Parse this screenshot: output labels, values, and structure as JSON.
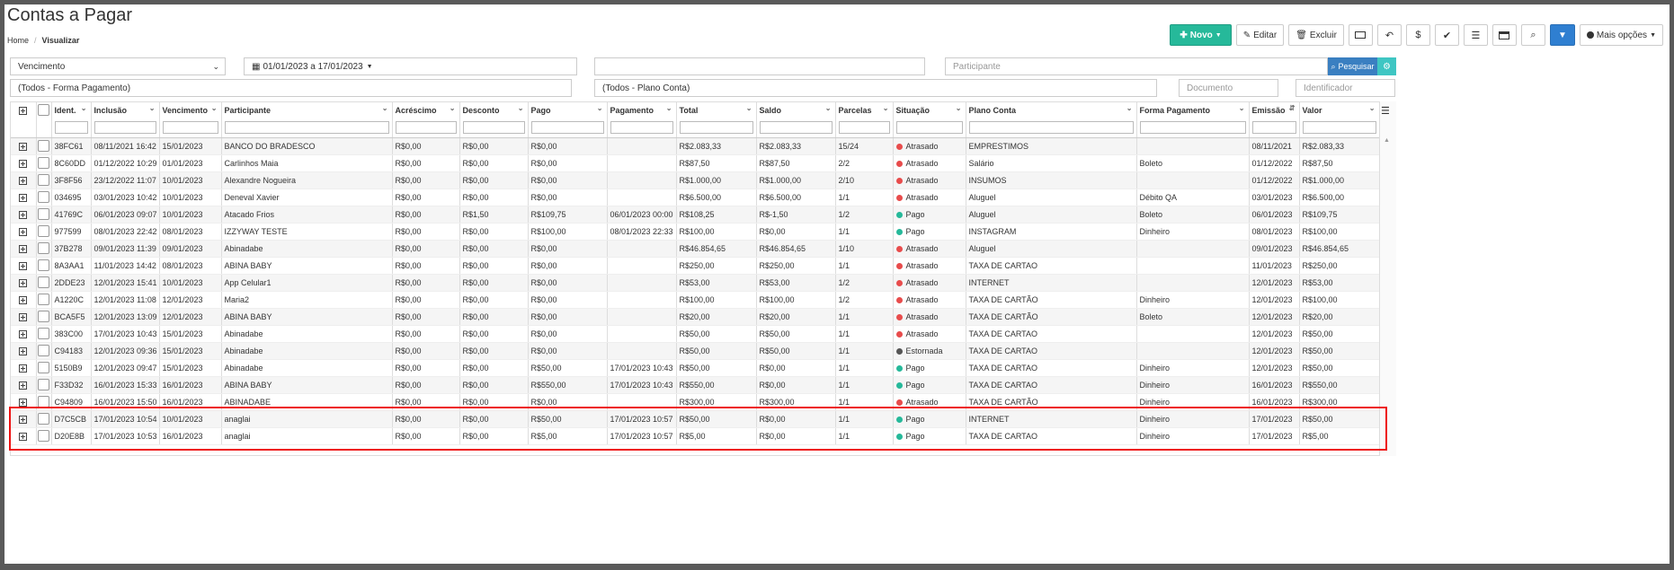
{
  "page": {
    "title": "Contas a Pagar"
  },
  "breadcrumb": {
    "home": "Home",
    "current": "Visualizar"
  },
  "toolbar": {
    "novo": "Novo",
    "editar": "Editar",
    "excluir": "Excluir",
    "mais_opcoes": "Mais opções",
    "dollar_glyph": "$"
  },
  "filters": {
    "date_field": "Vencimento",
    "date_range": "01/01/2023 a 17/01/2023",
    "text_search": "",
    "participante_placeholder": "Participante",
    "pesquisar": "Pesquisar",
    "forma_pagamento": "(Todos - Forma Pagamento)",
    "plano_conta": "(Todos - Plano Conta)",
    "documento_placeholder": "Documento",
    "identificador_placeholder": "Identificador"
  },
  "table": {
    "columns": [
      "Ident.",
      "Inclusão",
      "Vencimento",
      "Participante",
      "Acréscimo",
      "Desconto",
      "Pago",
      "Pagamento",
      "Total",
      "Saldo",
      "Parcelas",
      "Situação",
      "Plano Conta",
      "Forma Pagamento",
      "Emissão",
      "Valor"
    ],
    "status_colors": {
      "Atrasado": "#e84c4c",
      "Pago": "#26b99a",
      "Estornada": "#555555"
    },
    "rows": [
      [
        "38FC61",
        "08/11/2021 16:42",
        "15/01/2023",
        "BANCO DO BRADESCO",
        "R$0,00",
        "R$0,00",
        "R$0,00",
        "",
        "R$2.083,33",
        "R$2.083,33",
        "15/24",
        "Atrasado",
        "EMPRESTIMOS",
        "",
        "08/11/2021",
        "R$2.083,33"
      ],
      [
        "8C60DD",
        "01/12/2022 10:29",
        "01/01/2023",
        "Carlinhos Maia",
        "R$0,00",
        "R$0,00",
        "R$0,00",
        "",
        "R$87,50",
        "R$87,50",
        "2/2",
        "Atrasado",
        "Salário",
        "Boleto",
        "01/12/2022",
        "R$87,50"
      ],
      [
        "3F8F56",
        "23/12/2022 11:07",
        "10/01/2023",
        "Alexandre Nogueira",
        "R$0,00",
        "R$0,00",
        "R$0,00",
        "",
        "R$1.000,00",
        "R$1.000,00",
        "2/10",
        "Atrasado",
        "INSUMOS",
        "",
        "01/12/2022",
        "R$1.000,00"
      ],
      [
        "034695",
        "03/01/2023 10:42",
        "10/01/2023",
        "Deneval Xavier",
        "R$0,00",
        "R$0,00",
        "R$0,00",
        "",
        "R$6.500,00",
        "R$6.500,00",
        "1/1",
        "Atrasado",
        "Aluguel",
        "Débito QA",
        "03/01/2023",
        "R$6.500,00"
      ],
      [
        "41769C",
        "06/01/2023 09:07",
        "10/01/2023",
        "Atacado Frios",
        "R$0,00",
        "R$1,50",
        "R$109,75",
        "06/01/2023 00:00",
        "R$108,25",
        "R$-1,50",
        "1/2",
        "Pago",
        "Aluguel",
        "Boleto",
        "06/01/2023",
        "R$109,75"
      ],
      [
        "977599",
        "08/01/2023 22:42",
        "08/01/2023",
        "IZZYWAY TESTE",
        "R$0,00",
        "R$0,00",
        "R$100,00",
        "08/01/2023 22:33",
        "R$100,00",
        "R$0,00",
        "1/1",
        "Pago",
        "INSTAGRAM",
        "Dinheiro",
        "08/01/2023",
        "R$100,00"
      ],
      [
        "37B278",
        "09/01/2023 11:39",
        "09/01/2023",
        "Abinadabe",
        "R$0,00",
        "R$0,00",
        "R$0,00",
        "",
        "R$46.854,65",
        "R$46.854,65",
        "1/10",
        "Atrasado",
        "Aluguel",
        "",
        "09/01/2023",
        "R$46.854,65"
      ],
      [
        "8A3AA1",
        "11/01/2023 14:42",
        "08/01/2023",
        "ABINA BABY",
        "R$0,00",
        "R$0,00",
        "R$0,00",
        "",
        "R$250,00",
        "R$250,00",
        "1/1",
        "Atrasado",
        "TAXA DE CARTAO",
        "",
        "11/01/2023",
        "R$250,00"
      ],
      [
        "2DDE23",
        "12/01/2023 15:41",
        "10/01/2023",
        "App Celular1",
        "R$0,00",
        "R$0,00",
        "R$0,00",
        "",
        "R$53,00",
        "R$53,00",
        "1/2",
        "Atrasado",
        "INTERNET",
        "",
        "12/01/2023",
        "R$53,00"
      ],
      [
        "A1220C",
        "12/01/2023 11:08",
        "12/01/2023",
        "Maria2",
        "R$0,00",
        "R$0,00",
        "R$0,00",
        "",
        "R$100,00",
        "R$100,00",
        "1/2",
        "Atrasado",
        "TAXA DE CARTÃO",
        "Dinheiro",
        "12/01/2023",
        "R$100,00"
      ],
      [
        "BCA5F5",
        "12/01/2023 13:09",
        "12/01/2023",
        "ABINA BABY",
        "R$0,00",
        "R$0,00",
        "R$0,00",
        "",
        "R$20,00",
        "R$20,00",
        "1/1",
        "Atrasado",
        "TAXA DE CARTÃO",
        "Boleto",
        "12/01/2023",
        "R$20,00"
      ],
      [
        "383C00",
        "17/01/2023 10:43",
        "15/01/2023",
        "Abinadabe",
        "R$0,00",
        "R$0,00",
        "R$0,00",
        "",
        "R$50,00",
        "R$50,00",
        "1/1",
        "Atrasado",
        "TAXA DE CARTAO",
        "",
        "12/01/2023",
        "R$50,00"
      ],
      [
        "C94183",
        "12/01/2023 09:36",
        "15/01/2023",
        "Abinadabe",
        "R$0,00",
        "R$0,00",
        "R$0,00",
        "",
        "R$50,00",
        "R$50,00",
        "1/1",
        "Estornada",
        "TAXA DE CARTAO",
        "",
        "12/01/2023",
        "R$50,00"
      ],
      [
        "5150B9",
        "12/01/2023 09:47",
        "15/01/2023",
        "Abinadabe",
        "R$0,00",
        "R$0,00",
        "R$50,00",
        "17/01/2023 10:43",
        "R$50,00",
        "R$0,00",
        "1/1",
        "Pago",
        "TAXA DE CARTAO",
        "Dinheiro",
        "12/01/2023",
        "R$50,00"
      ],
      [
        "F33D32",
        "16/01/2023 15:33",
        "16/01/2023",
        "ABINA BABY",
        "R$0,00",
        "R$0,00",
        "R$550,00",
        "17/01/2023 10:43",
        "R$550,00",
        "R$0,00",
        "1/1",
        "Pago",
        "TAXA DE CARTAO",
        "Dinheiro",
        "16/01/2023",
        "R$550,00"
      ],
      [
        "C94809",
        "16/01/2023 15:50",
        "16/01/2023",
        "ABINADABE",
        "R$0,00",
        "R$0,00",
        "R$0,00",
        "",
        "R$300,00",
        "R$300,00",
        "1/1",
        "Atrasado",
        "TAXA DE CARTÃO",
        "Dinheiro",
        "16/01/2023",
        "R$300,00"
      ],
      [
        "D7C5CB",
        "17/01/2023 10:54",
        "10/01/2023",
        "anaglai",
        "R$0,00",
        "R$0,00",
        "R$50,00",
        "17/01/2023 10:57",
        "R$50,00",
        "R$0,00",
        "1/1",
        "Pago",
        "INTERNET",
        "Dinheiro",
        "17/01/2023",
        "R$50,00"
      ],
      [
        "D20E8B",
        "17/01/2023 10:53",
        "16/01/2023",
        "anaglai",
        "R$0,00",
        "R$0,00",
        "R$5,00",
        "17/01/2023 10:57",
        "R$5,00",
        "R$0,00",
        "1/1",
        "Pago",
        "TAXA DE CARTAO",
        "Dinheiro",
        "17/01/2023",
        "R$5,00"
      ]
    ]
  }
}
